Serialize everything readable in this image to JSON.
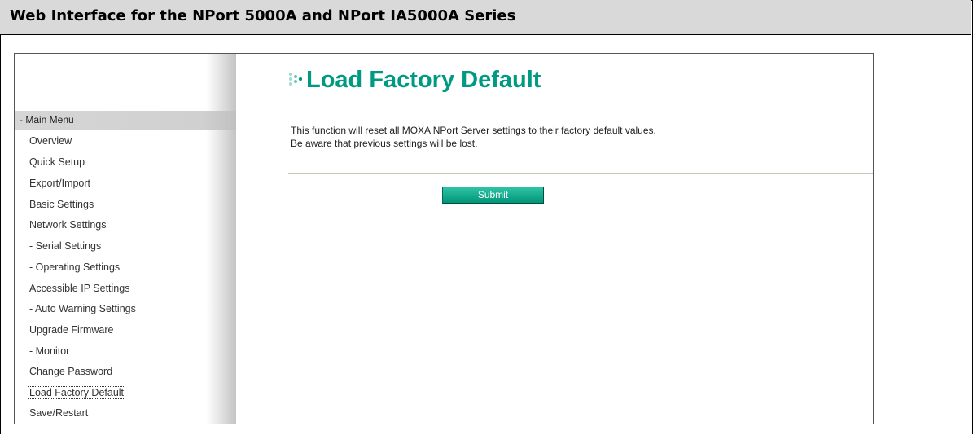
{
  "document": {
    "title": "Web Interface for the NPort 5000A and NPort IA5000A Series"
  },
  "sidebar": {
    "menu_header": "- Main Menu",
    "items": [
      {
        "label": "Overview"
      },
      {
        "label": "Quick Setup"
      },
      {
        "label": "Export/Import"
      },
      {
        "label": "Basic Settings"
      },
      {
        "label": "Network Settings"
      },
      {
        "label": "- Serial Settings"
      },
      {
        "label": "- Operating Settings"
      },
      {
        "label": "Accessible IP Settings"
      },
      {
        "label": "- Auto Warning Settings"
      },
      {
        "label": "Upgrade Firmware"
      },
      {
        "label": "- Monitor"
      },
      {
        "label": "Change Password"
      },
      {
        "label": "Load Factory Default",
        "active": true
      },
      {
        "label": "Save/Restart"
      }
    ]
  },
  "main": {
    "title": "Load Factory Default",
    "description_line1": "This function will reset all MOXA NPort Server settings to their factory default values.",
    "description_line2": "Be aware that previous settings will be lost.",
    "submit_label": "Submit"
  },
  "colors": {
    "accent": "#009a82",
    "button": "#00a080",
    "header_bg": "#d9d9d9",
    "menu_header_bg": "#d0d0d0"
  },
  "icons": {
    "title_bullet": "dots-bullet-icon"
  }
}
